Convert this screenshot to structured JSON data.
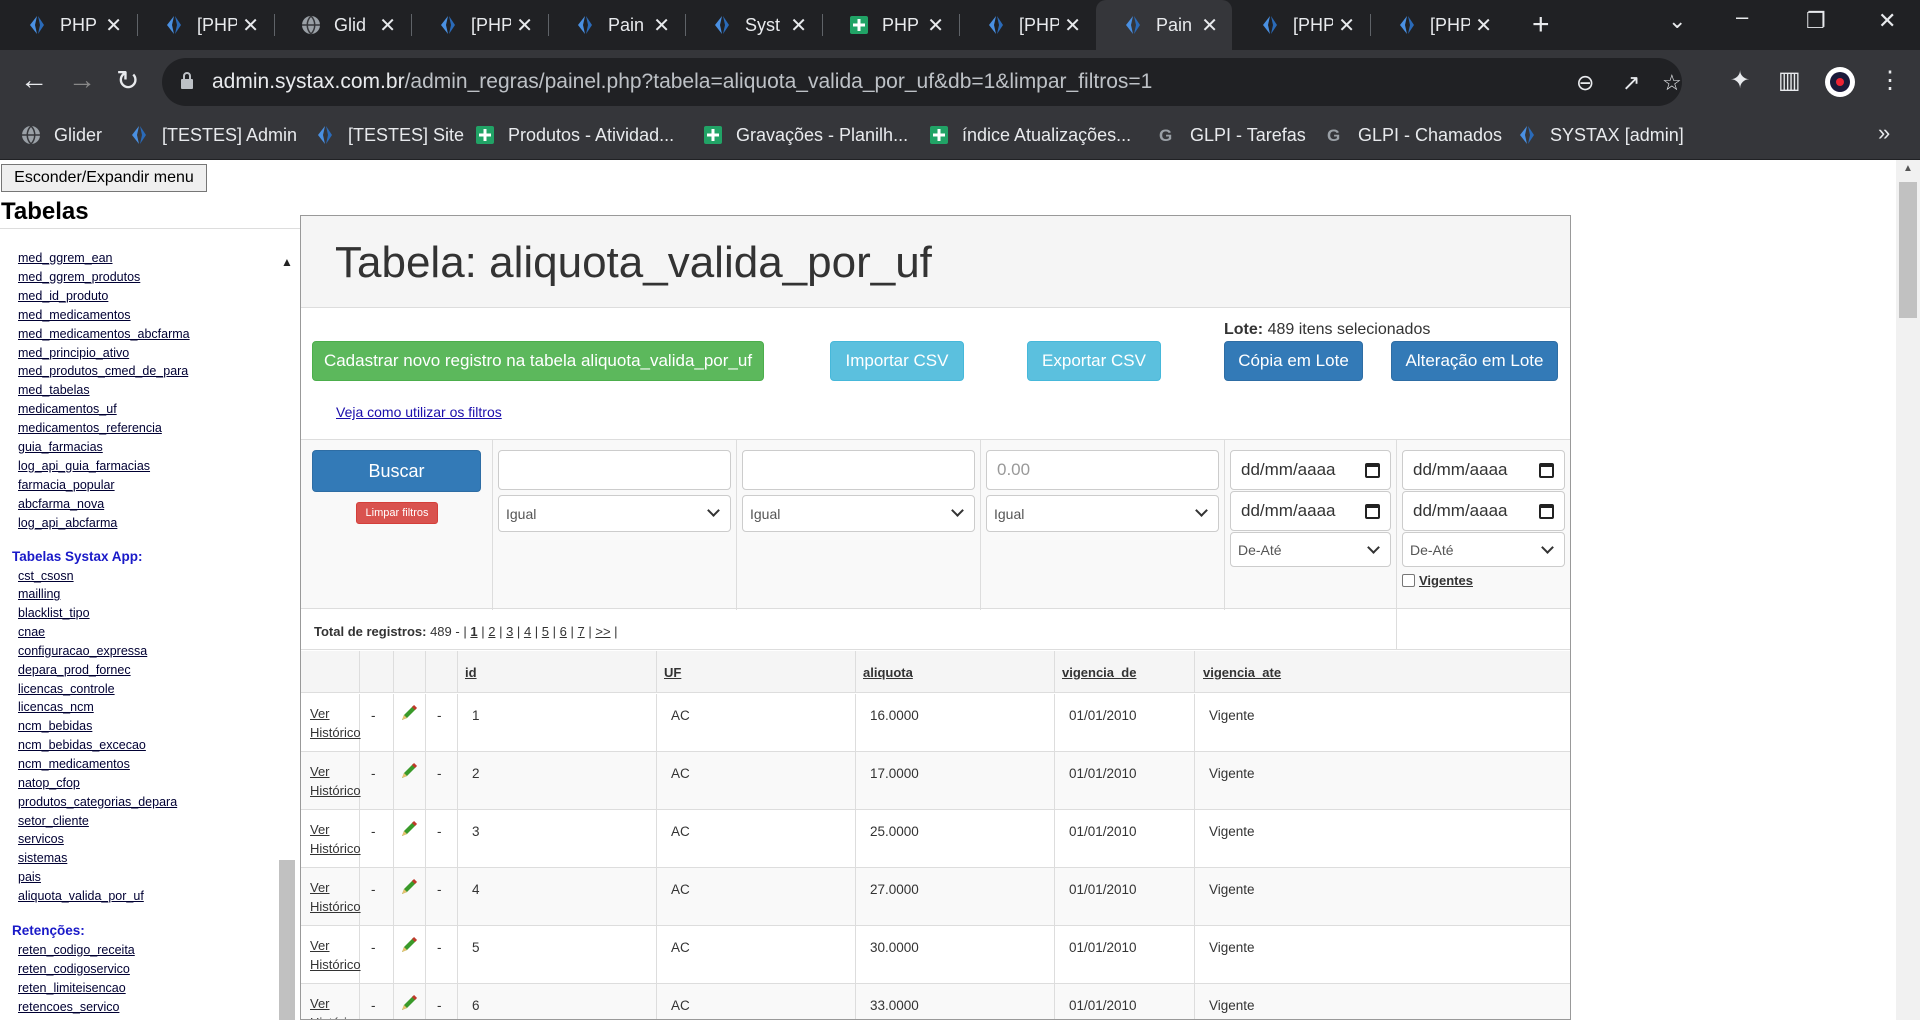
{
  "browser": {
    "tabs": [
      {
        "label": "PHP",
        "icon": "systax-icon"
      },
      {
        "label": "[PHP",
        "icon": "systax-icon"
      },
      {
        "label": "Glid",
        "icon": "globe-icon"
      },
      {
        "label": "[PHP",
        "icon": "systax-icon"
      },
      {
        "label": "Pain",
        "icon": "systax-icon"
      },
      {
        "label": "Syst",
        "icon": "systax-icon"
      },
      {
        "label": "PHP",
        "icon": "sheets-icon"
      },
      {
        "label": "[PHP",
        "icon": "systax-icon"
      },
      {
        "label": "Pain",
        "icon": "systax-icon"
      },
      {
        "label": "[PHP",
        "icon": "systax-icon"
      },
      {
        "label": "[PHP",
        "icon": "systax-icon"
      }
    ],
    "active_tab": 8,
    "url_host": "admin.systax.com.br",
    "url_path": "/admin_regras/painel.php?tabela=aliquota_valida_por_uf&db=1&limpar_filtros=1",
    "bookmarks": [
      {
        "label": "Glider",
        "icon": "globe-icon"
      },
      {
        "label": "[TESTES] Admin",
        "icon": "systax-icon"
      },
      {
        "label": "[TESTES] Site",
        "icon": "systax-icon"
      },
      {
        "label": "Produtos - Atividad...",
        "icon": "sheets-icon"
      },
      {
        "label": "Gravações - Planilh...",
        "icon": "sheets-icon"
      },
      {
        "label": "índice Atualizações...",
        "icon": "sheets-icon"
      },
      {
        "label": "GLPI - Tarefas",
        "icon": "glpi-icon"
      },
      {
        "label": "GLPI - Chamados",
        "icon": "glpi-icon"
      },
      {
        "label": "SYSTAX [admin]",
        "icon": "systax-icon"
      }
    ],
    "bookmarks_more": "»"
  },
  "sidebar": {
    "toggle_label": "Esconder/Expandir menu",
    "title": "Tabelas",
    "links_a": [
      "med_ggrem_ean",
      "med_ggrem_produtos",
      "med_id_produto",
      "med_medicamentos",
      "med_medicamentos_abcfarma",
      "med_principio_ativo",
      "med_produtos_cmed_de_para",
      "med_tabelas",
      "medicamentos_uf",
      "medicamentos_referencia",
      "guia_farmacias",
      "log_api_guia_farmacias",
      "farmacia_popular",
      "abcfarma_nova",
      "log_api_abcfarma"
    ],
    "group_b": "Tabelas Systax App:",
    "links_b": [
      "cst_csosn",
      "mailling",
      "blacklist_tipo",
      "cnae",
      "configuracao_expressa",
      "depara_prod_fornec",
      "licencas_controle",
      "licencas_ncm",
      "ncm_bebidas",
      "ncm_bebidas_excecao",
      "ncm_medicamentos",
      "natop_cfop",
      "produtos_categorias_depara",
      "setor_cliente",
      "servicos",
      "sistemas",
      "pais",
      "aliquota_valida_por_uf"
    ],
    "group_c": "Retenções:",
    "links_c": [
      "reten_codigo_receita",
      "reten_codigoservico",
      "reten_limiteisencao",
      "retencoes_servico"
    ]
  },
  "panel": {
    "title": "Tabela: aliquota_valida_por_uf",
    "btn_new": "Cadastrar novo registro na tabela aliquota_valida_por_uf",
    "btn_import": "Importar CSV",
    "btn_export": "Exportar CSV",
    "lote_label": "Lote:",
    "lote_text": "489 itens selecionados",
    "btn_copy": "Cópia em Lote",
    "btn_alter": "Alteração em Lote",
    "filters_link": "Veja como utilizar os filtros",
    "btn_search": "Buscar",
    "btn_clear": "Limpar filtros",
    "filter_aliquota_placeholder": "0.00",
    "op_equal": "Igual",
    "date_placeholder": "dd/mm/aaaa",
    "range_label": "De-Até",
    "vigentes_label": "Vigentes",
    "total_label": "Total de registros:",
    "total_value": "489",
    "pages_prefix": "-  |",
    "pages": [
      "1",
      "2",
      "3",
      "4",
      "5",
      "6",
      "7",
      ">>"
    ]
  },
  "table": {
    "columns": {
      "id": "id",
      "uf": "UF",
      "aliquota": "aliquota",
      "vig_de": "vigencia_de",
      "vig_ate": "vigencia_ate"
    },
    "hist_label_1": "Ver",
    "hist_label_2": "Histórico",
    "dash": "-",
    "rows": [
      {
        "id": "1",
        "uf": "AC",
        "aliquota": "16.0000",
        "de": "01/01/2010",
        "ate": "Vigente"
      },
      {
        "id": "2",
        "uf": "AC",
        "aliquota": "17.0000",
        "de": "01/01/2010",
        "ate": "Vigente"
      },
      {
        "id": "3",
        "uf": "AC",
        "aliquota": "25.0000",
        "de": "01/01/2010",
        "ate": "Vigente"
      },
      {
        "id": "4",
        "uf": "AC",
        "aliquota": "27.0000",
        "de": "01/01/2010",
        "ate": "Vigente"
      },
      {
        "id": "5",
        "uf": "AC",
        "aliquota": "30.0000",
        "de": "01/01/2010",
        "ate": "Vigente"
      },
      {
        "id": "6",
        "uf": "AC",
        "aliquota": "33.0000",
        "de": "01/01/2010",
        "ate": "Vigente"
      }
    ]
  },
  "colors": {
    "accent_green": "#5cb85c",
    "accent_cyan": "#5bc0de",
    "accent_blue": "#337ab7",
    "danger": "#d9534f"
  }
}
